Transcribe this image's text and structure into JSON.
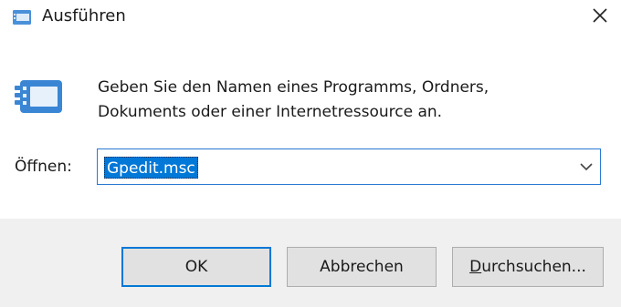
{
  "window": {
    "title": "Ausführen",
    "icon": "run-dialog-icon",
    "close_icon": "close-icon"
  },
  "body": {
    "icon": "run-program-icon",
    "description_line1": "Geben Sie den Namen eines Programms, Ordners,",
    "description_line2": "Dokuments oder einer Internetressource an.",
    "open_label": "Öffnen:",
    "open_value": "Gpedit.msc",
    "dropdown_icon": "chevron-down-icon"
  },
  "buttons": {
    "ok_label": "OK",
    "cancel_label": "Abbrechen",
    "browse_label_mnemonic": "D",
    "browse_label_rest": "urchsuchen..."
  },
  "colors": {
    "accent": "#0078d7",
    "button_face": "#e1e1e1",
    "button_bar": "#f0f0f0"
  }
}
